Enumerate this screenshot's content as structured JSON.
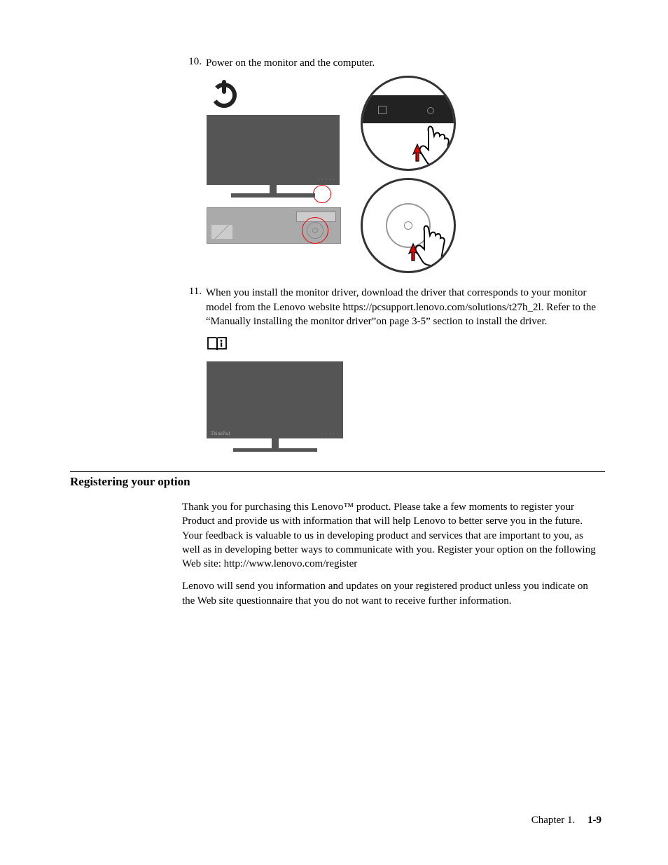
{
  "steps": {
    "s10": {
      "num": "10.",
      "text": "Power on the monitor and the computer."
    },
    "s11": {
      "num": "11.",
      "text": "When you install the monitor driver, download the driver that corresponds to your monitor model from the Lenovo website https://pcsupport.lenovo.com/solutions/t27h_2l. Refer to the “Manually installing the monitor driver”on page 3-5” section to install the driver."
    }
  },
  "section": {
    "title": "Registering your option",
    "p1": "Thank you for purchasing this Lenovo™ product. Please take a few moments to register your Product and provide us with information that will help Lenovo to better serve you in the future. Your feedback is valuable to us in developing product and services that are important to you, as well as in developing better ways to communicate with you. Register your option on the following Web site: http://www.lenovo.com/register",
    "p2": "Lenovo will send you information and updates on your registered product unless you indicate on the Web site questionnaire that you do not want to receive further information."
  },
  "footer": {
    "chapter": "Chapter 1.",
    "page": "1-9"
  }
}
